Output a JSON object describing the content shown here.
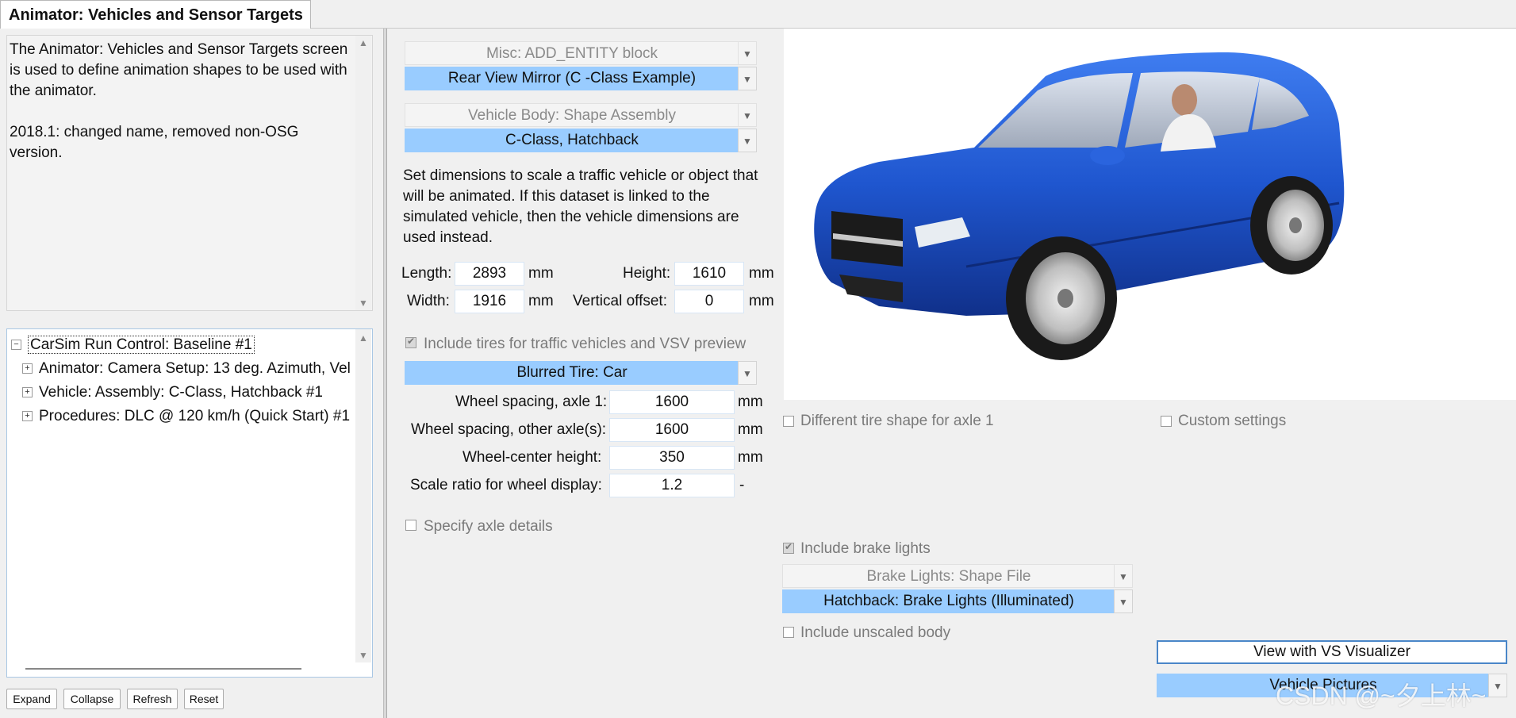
{
  "tab": {
    "title": "Animator: Vehicles and Sensor Targets"
  },
  "notes": {
    "text": "The Animator: Vehicles and Sensor Targets screen is used to define animation shapes to be used with the animator.\n\n2018.1: changed name, removed non-OSG version."
  },
  "tree": {
    "root": "CarSim Run Control: Baseline #1",
    "children": [
      "Animator: Camera Setup: 13 deg. Azimuth, Vel",
      "Vehicle: Assembly: C-Class, Hatchback #1",
      "Procedures: DLC @ 120 km/h (Quick Start) #1"
    ]
  },
  "tree_buttons": {
    "expand": "Expand",
    "collapse": "Collapse",
    "refresh": "Refresh",
    "reset": "Reset"
  },
  "misc": {
    "category": "Misc: ADD_ENTITY block",
    "dataset": "Rear View Mirror (C -Class Example)"
  },
  "body": {
    "category": "Vehicle Body: Shape Assembly",
    "dataset": "C-Class, Hatchback"
  },
  "dimensions": {
    "instructions": "Set dimensions to scale a traffic vehicle or object that will be animated. If this dataset is linked to the simulated vehicle, then the vehicle dimensions are used instead.",
    "length_label": "Length:",
    "length": "2893",
    "length_unit": "mm",
    "height_label": "Height:",
    "height": "1610",
    "height_unit": "mm",
    "width_label": "Width:",
    "width": "1916",
    "width_unit": "mm",
    "voffset_label": "Vertical offset:",
    "voffset": "0",
    "voffset_unit": "mm"
  },
  "tires": {
    "include_label": "Include tires for traffic vehicles and VSV preview",
    "include_checked": true,
    "dataset": "Blurred Tire: Car",
    "axle1_label": "Wheel spacing, axle 1:",
    "axle1": "1600",
    "axle1_unit": "mm",
    "other_label": "Wheel spacing, other axle(s):",
    "other": "1600",
    "other_unit": "mm",
    "center_label": "Wheel-center height:",
    "center": "350",
    "center_unit": "mm",
    "scale_label": "Scale ratio for wheel display:",
    "scale": "1.2",
    "scale_unit": "-",
    "axle_details_label": "Specify axle details",
    "different_shape_label": "Different tire shape for axle 1",
    "custom_label": "Custom settings"
  },
  "brake": {
    "include_label": "Include brake lights",
    "include_checked": true,
    "category": "Brake Lights: Shape File",
    "dataset": "Hatchback: Brake Lights (Illuminated)",
    "unscaled_label": "Include unscaled body"
  },
  "actions": {
    "visualizer": "View with VS Visualizer",
    "pictures": "Vehicle Pictures"
  },
  "watermark": "CSDN @~夕上林~",
  "colors": {
    "selected_combo": "#99ccff",
    "car_body": "#1a4fc4",
    "tree_border": "#a9c7e4"
  },
  "icons": {
    "scroll_up": "triangle-up-icon",
    "scroll_down": "triangle-down-icon",
    "combo": "triangle-down-icon",
    "tree": "plus-box-icon"
  }
}
